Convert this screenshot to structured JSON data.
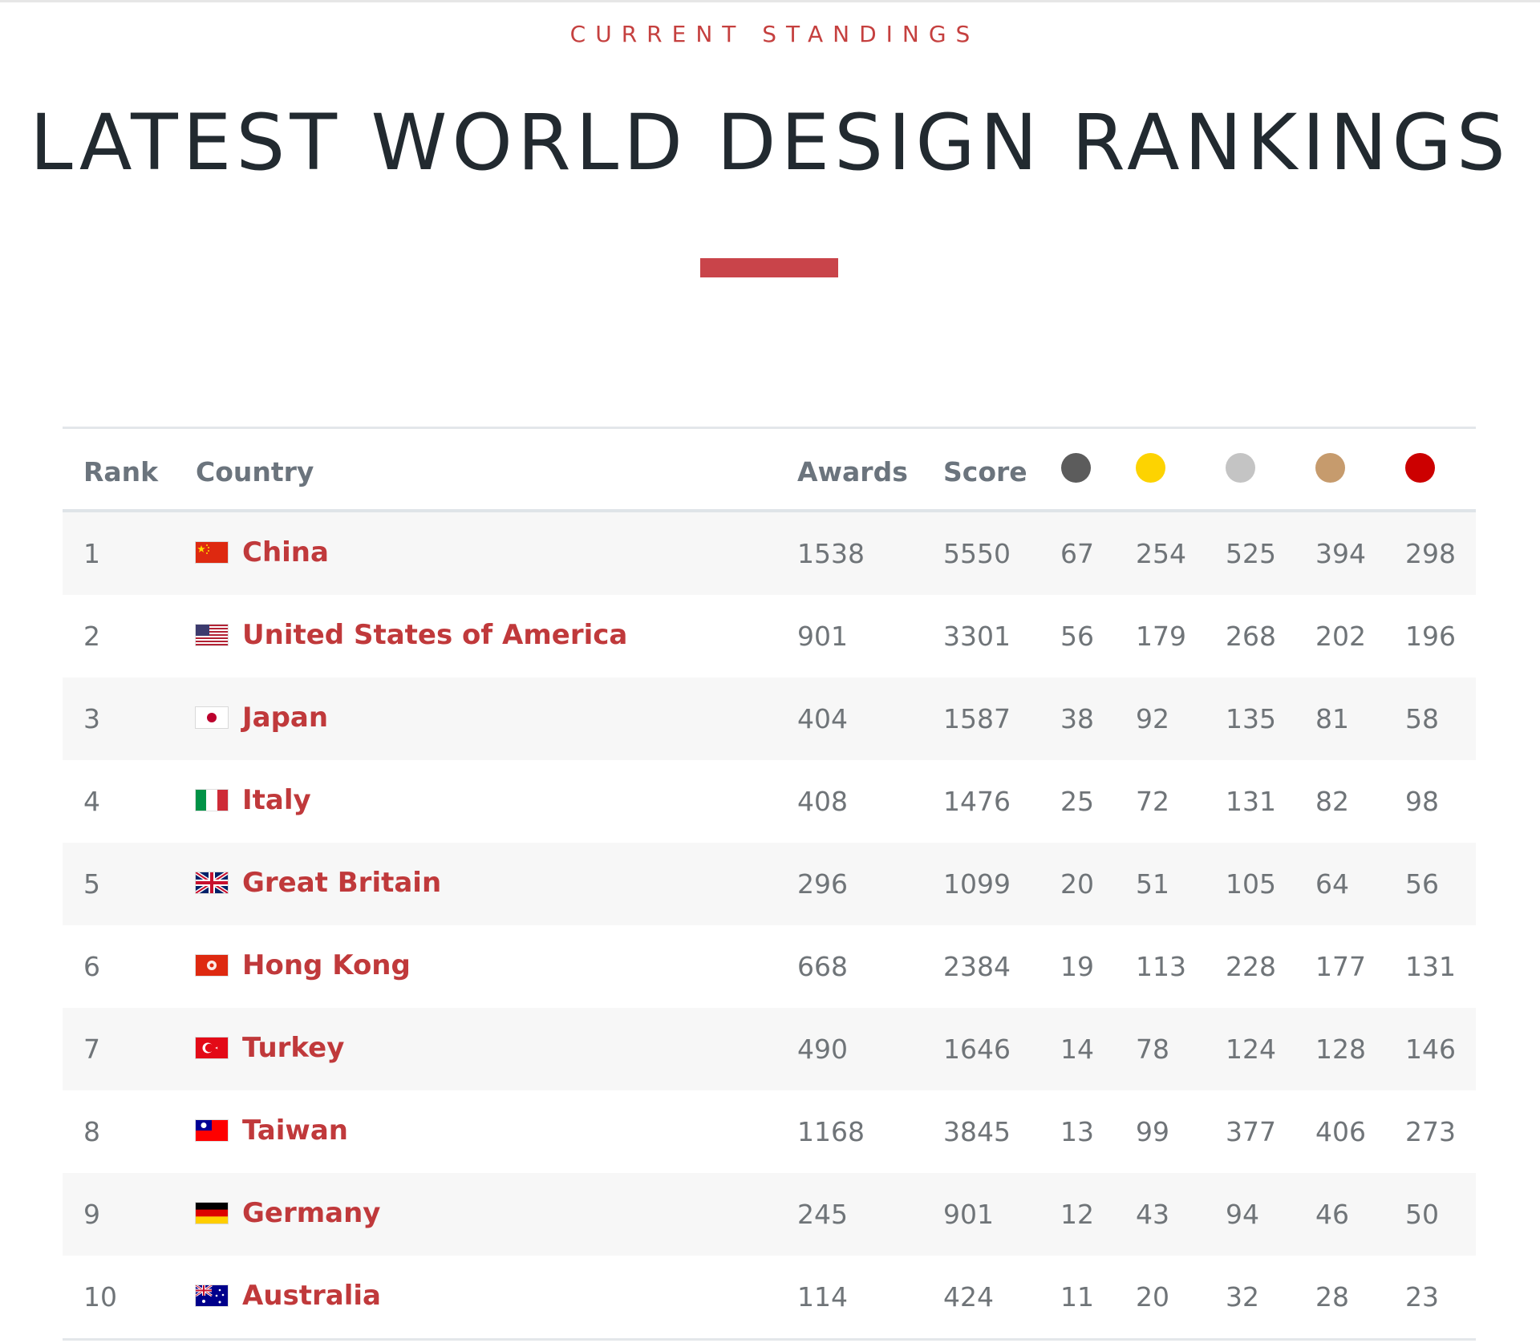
{
  "header": {
    "eyebrow": "CURRENT STANDINGS",
    "title": "LATEST WORLD DESIGN RANKINGS",
    "accent_color": "#c9444a"
  },
  "table": {
    "columns": {
      "rank": "Rank",
      "country": "Country",
      "awards": "Awards",
      "score": "Score"
    },
    "medal_colors": [
      "#5c5c5c",
      "#fdd301",
      "#c4c4c4",
      "#c69b6d",
      "#cc0000"
    ],
    "rows": [
      {
        "rank": "1",
        "country": "China",
        "flag": "cn-flag-icon",
        "awards": "1538",
        "score": "5550",
        "m": [
          "67",
          "254",
          "525",
          "394",
          "298"
        ]
      },
      {
        "rank": "2",
        "country": "United States of America",
        "flag": "us-flag-icon",
        "awards": "901",
        "score": "3301",
        "m": [
          "56",
          "179",
          "268",
          "202",
          "196"
        ]
      },
      {
        "rank": "3",
        "country": "Japan",
        "flag": "jp-flag-icon",
        "awards": "404",
        "score": "1587",
        "m": [
          "38",
          "92",
          "135",
          "81",
          "58"
        ]
      },
      {
        "rank": "4",
        "country": "Italy",
        "flag": "it-flag-icon",
        "awards": "408",
        "score": "1476",
        "m": [
          "25",
          "72",
          "131",
          "82",
          "98"
        ]
      },
      {
        "rank": "5",
        "country": "Great Britain",
        "flag": "gb-flag-icon",
        "awards": "296",
        "score": "1099",
        "m": [
          "20",
          "51",
          "105",
          "64",
          "56"
        ]
      },
      {
        "rank": "6",
        "country": "Hong Kong",
        "flag": "hk-flag-icon",
        "awards": "668",
        "score": "2384",
        "m": [
          "19",
          "113",
          "228",
          "177",
          "131"
        ]
      },
      {
        "rank": "7",
        "country": "Turkey",
        "flag": "tr-flag-icon",
        "awards": "490",
        "score": "1646",
        "m": [
          "14",
          "78",
          "124",
          "128",
          "146"
        ]
      },
      {
        "rank": "8",
        "country": "Taiwan",
        "flag": "tw-flag-icon",
        "awards": "1168",
        "score": "3845",
        "m": [
          "13",
          "99",
          "377",
          "406",
          "273"
        ]
      },
      {
        "rank": "9",
        "country": "Germany",
        "flag": "de-flag-icon",
        "awards": "245",
        "score": "901",
        "m": [
          "12",
          "43",
          "94",
          "46",
          "50"
        ]
      },
      {
        "rank": "10",
        "country": "Australia",
        "flag": "au-flag-icon",
        "awards": "114",
        "score": "424",
        "m": [
          "11",
          "20",
          "32",
          "28",
          "23"
        ]
      }
    ]
  }
}
